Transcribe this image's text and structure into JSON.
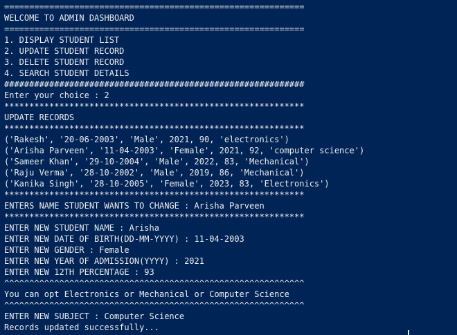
{
  "terminal": {
    "lines": [
      "============================================================",
      "WELCOME TO ADMIN DASHBOARD",
      "============================================================",
      "1. DISPLAY STUDENT LIST",
      "2. UPDATE STUDENT RECORD",
      "3. DELETE STUDENT RECORD",
      "4. SEARCH STUDENT DETAILS",
      "############################################################",
      "Enter your choice : 2",
      "************************************************************",
      "UPDATE RECORDS",
      "************************************************************",
      "('Rakesh', '20-06-2003', 'Male', 2021, 90, 'electronics')",
      "('Arisha Parveen', '11-04-2003', 'Female', 2021, 92, 'computer science')",
      "('Sameer Khan', '29-10-2004', 'Male', 2022, 83, 'Mechanical')",
      "('Raju Verma', '28-10-2002', 'Male', 2019, 86, 'Mechanical')",
      "('Kanika Singh', '28-10-2005', 'Female', 2023, 83, 'Electronics')",
      "************************************************************",
      "ENTERS NAME STUDENT WANTS TO CHANGE : Arisha Parveen",
      "************************************************************",
      "ENTER NEW STUDENT NAME : Arisha",
      "ENTER NEW DATE OF BIRTH(DD-MM-YYYY) : 11-04-2003",
      "ENTER NEW GENDER : Female",
      "ENTER NEW YEAR OF ADMISSION(YYYY) : 2021",
      "ENTER NEW 12TH PERCENTAGE : 93",
      "^^^^^^^^^^^^^^^^^^^^^^^^^^^^^^^^^^^^^^^^^^^^^^^^^^^^^^^^^^^^",
      "You can opt Electronics or Mechanical or Computer Science",
      "^^^^^^^^^^^^^^^^^^^^^^^^^^^^^^^^^^^^^^^^^^^^^^^^^^^^^^^^^^^^",
      "ENTER NEW SUBJECT : Computer Science",
      "Records updated successfully..."
    ]
  }
}
